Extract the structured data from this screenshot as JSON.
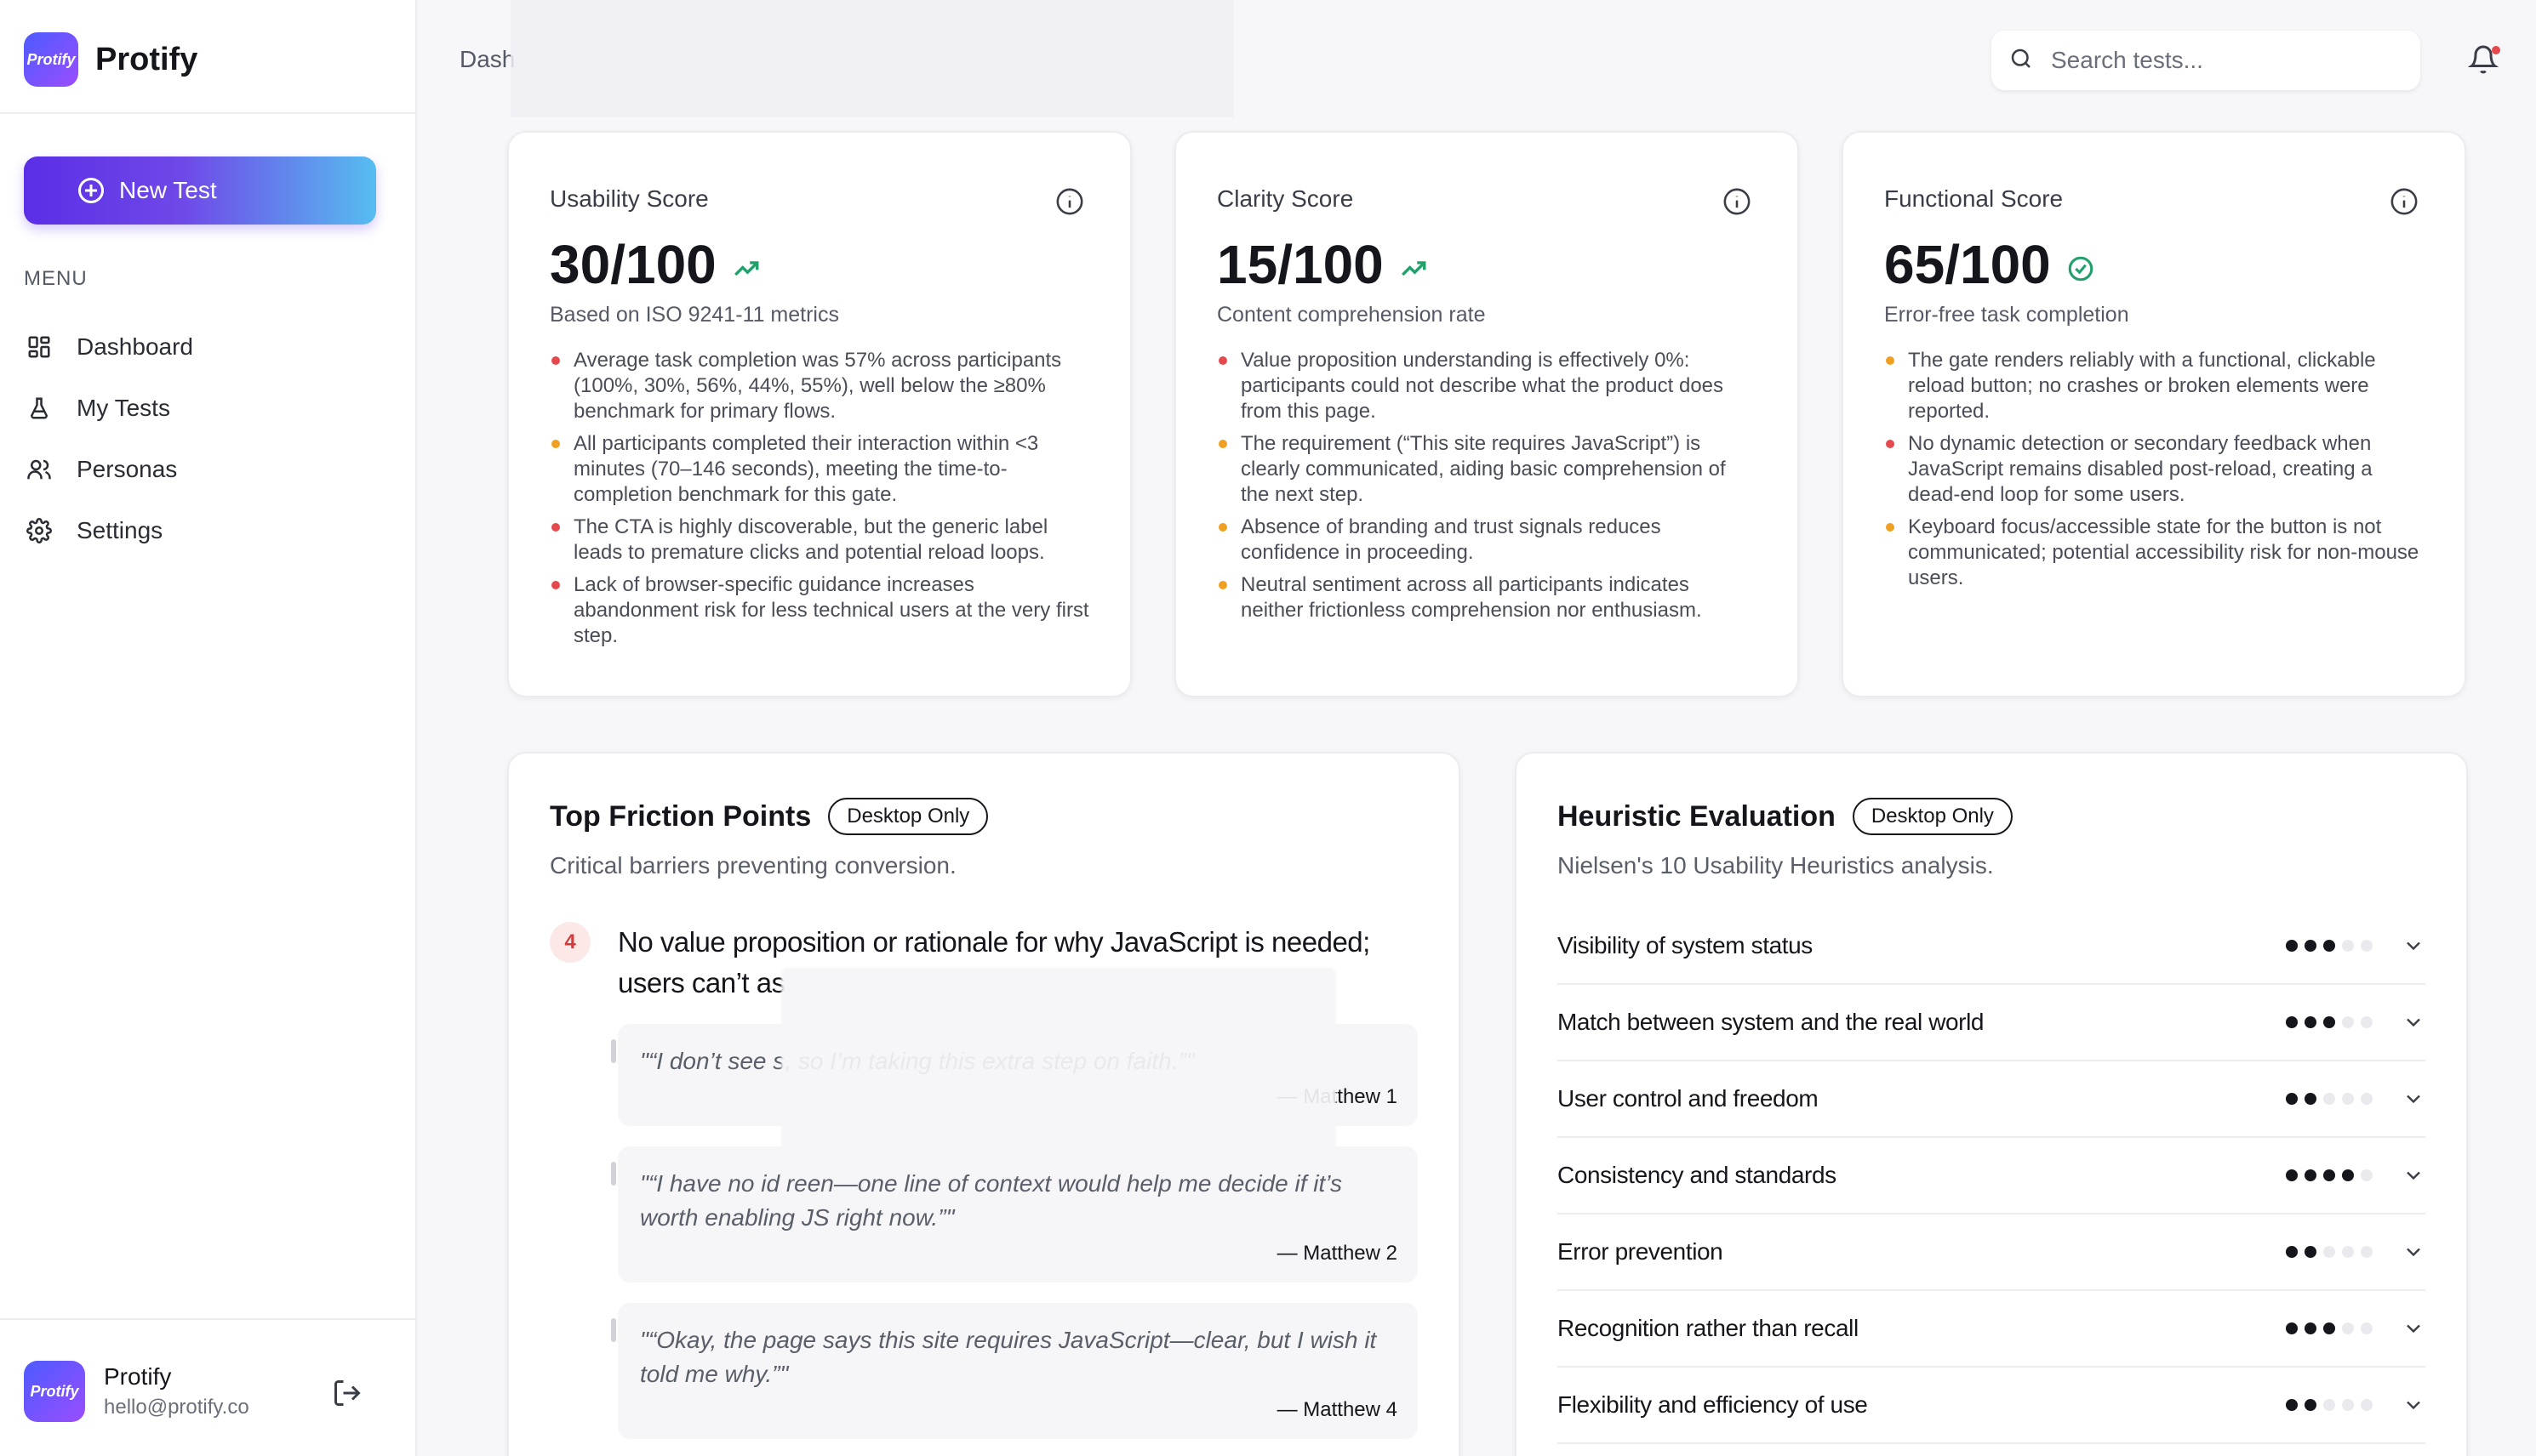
{
  "brand": {
    "name": "Protify",
    "logo_text": "Protify"
  },
  "sidebar": {
    "new_test_label": "New Test",
    "menu_label": "MENU",
    "items": [
      {
        "label": "Dashboard",
        "icon": "grid-icon"
      },
      {
        "label": "My Tests",
        "icon": "flask-icon"
      },
      {
        "label": "Personas",
        "icon": "users-icon"
      },
      {
        "label": "Settings",
        "icon": "gear-icon"
      }
    ],
    "user": {
      "name": "Protify",
      "email": "hello@protify.co"
    }
  },
  "header": {
    "breadcrumb": "Dash",
    "search_placeholder": "Search tests..."
  },
  "scores": [
    {
      "title": "Usability Score",
      "value": "30/100",
      "trend_icon": "trend-up-icon",
      "subtitle": "Based on ISO 9241-11 metrics",
      "bullets": [
        {
          "severity": "red",
          "text": "Average task completion was 57% across participants (100%, 30%, 56%, 44%, 55%), well below the ≥80% benchmark for primary flows."
        },
        {
          "severity": "amber",
          "text": "All participants completed their interaction within <3 minutes (70–146 seconds), meeting the time-to-completion benchmark for this gate."
        },
        {
          "severity": "red",
          "text": "The CTA is highly discoverable, but the generic label leads to premature clicks and potential reload loops."
        },
        {
          "severity": "red",
          "text": "Lack of browser-specific guidance increases abandonment risk for less technical users at the very first step."
        }
      ]
    },
    {
      "title": "Clarity Score",
      "value": "15/100",
      "trend_icon": "trend-up-icon",
      "subtitle": "Content comprehension rate",
      "bullets": [
        {
          "severity": "red",
          "text": "Value proposition understanding is effectively 0%: participants could not describe what the product does from this page."
        },
        {
          "severity": "amber",
          "text": "The requirement (“This site requires JavaScript”) is clearly communicated, aiding basic comprehension of the next step."
        },
        {
          "severity": "amber",
          "text": "Absence of branding and trust signals reduces confidence in proceeding."
        },
        {
          "severity": "amber",
          "text": "Neutral sentiment across all participants indicates neither frictionless comprehension nor enthusiasm."
        }
      ]
    },
    {
      "title": "Functional Score",
      "value": "65/100",
      "trend_icon": "check-circle-icon",
      "subtitle": "Error-free task completion",
      "bullets": [
        {
          "severity": "amber",
          "text": "The gate renders reliably with a functional, clickable reload button; no crashes or broken elements were reported."
        },
        {
          "severity": "red",
          "text": "No dynamic detection or secondary feedback when JavaScript remains disabled post-reload, creating a dead-end loop for some users."
        },
        {
          "severity": "amber",
          "text": "Keyboard focus/accessible state for the button is not communicated; potential accessibility risk for non-mouse users."
        }
      ]
    }
  ],
  "colors": {
    "red": "#e5484d",
    "amber": "#f0a020",
    "green": "#22a06b",
    "accent": "#5a2ee6"
  },
  "friction": {
    "title": "Top Friction Points",
    "badge": "Desktop Only",
    "subtitle": "Critical barriers preventing conversion.",
    "items": [
      {
        "number": "4",
        "text": "No value proposition or rationale for why JavaScript is needed; users can’t as",
        "quotes": [
          {
            "text": "\"“I don’t see                                                       s, so I’m taking this extra step on faith.”\"",
            "author": "— Matthew 1"
          },
          {
            "text": "\"“I have no id                                                        reen—one line of context would help me decide if it’s worth enabling JS right now.”\"",
            "author": "— Matthew 2"
          },
          {
            "text": "\"“Okay, the page says this site requires JavaScript—clear, but I wish it told me why.”\"",
            "author": "— Matthew 4"
          }
        ]
      }
    ]
  },
  "heuristic": {
    "title": "Heuristic Evaluation",
    "badge": "Desktop Only",
    "subtitle": "Nielsen's 10 Usability Heuristics analysis.",
    "rows": [
      {
        "label": "Visibility of system status",
        "rating": 3
      },
      {
        "label": "Match between system and the real world",
        "rating": 3
      },
      {
        "label": "User control and freedom",
        "rating": 2
      },
      {
        "label": "Consistency and standards",
        "rating": 4
      },
      {
        "label": "Error prevention",
        "rating": 2
      },
      {
        "label": "Recognition rather than recall",
        "rating": 3
      },
      {
        "label": "Flexibility and efficiency of use",
        "rating": 2
      }
    ]
  }
}
